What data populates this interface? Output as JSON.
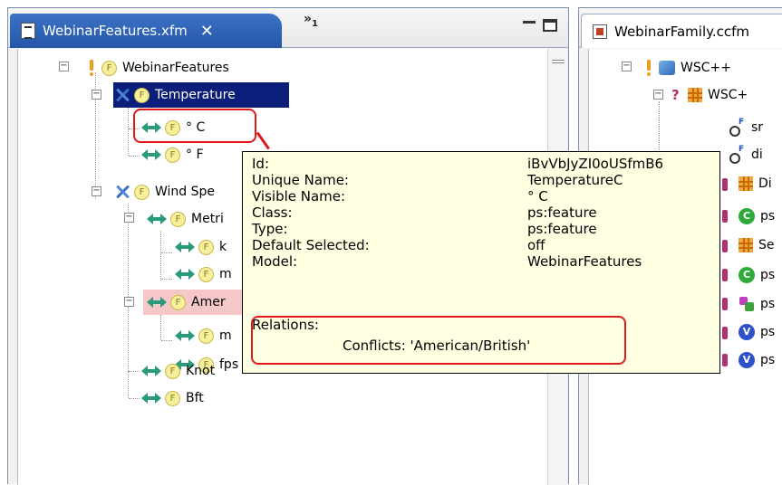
{
  "left_editor": {
    "tab_label": "WebinarFeatures.xfm",
    "close_glyph": "✕",
    "overflow_label": "»",
    "overflow_count": "1"
  },
  "tree": {
    "root": "WebinarFeatures",
    "temperature": "Temperature",
    "celsius": "° C",
    "fahrenheit": "° F",
    "wind_speed": "Wind Spe",
    "metric": "Metri",
    "metric_child_1": "k",
    "metric_child_2": "m",
    "american": "Amer",
    "american_child_1": "m",
    "american_child_2": "fps",
    "knot": "Knot",
    "bft": "Bft",
    "feature_icon_letter": "F"
  },
  "tooltip": {
    "rows": [
      {
        "key": "Id:",
        "value": "iBvVbJyZI0oUSfmB6"
      },
      {
        "key": "Unique Name:",
        "value": "TemperatureC"
      },
      {
        "key": "Visible Name:",
        "value": "° C"
      },
      {
        "key": "Class:",
        "value": "ps:feature"
      },
      {
        "key": "Type:",
        "value": "ps:feature"
      },
      {
        "key": "Default Selected:",
        "value": "off"
      },
      {
        "key": "Model:",
        "value": "WebinarFeatures"
      }
    ],
    "relations_label": "Relations:",
    "conflicts": "Conflicts: 'American/British'"
  },
  "right_editor": {
    "tab_label": "WebinarFamily.ccfm",
    "items": [
      {
        "label": "WSC++"
      },
      {
        "label": "WSC+"
      },
      {
        "label": "sr"
      },
      {
        "label": "di"
      },
      {
        "label": "Di"
      },
      {
        "label": "ps"
      },
      {
        "label": "Se"
      },
      {
        "label": "ps"
      },
      {
        "label": "ps"
      },
      {
        "label": "ps"
      },
      {
        "label": "ps"
      }
    ]
  },
  "colors": {
    "selection": "#0b1f7a",
    "conflict_row": "#f6c7c7",
    "tooltip_bg": "#ffffe1",
    "annotation_red": "#e01818",
    "active_tab": "#2456a8"
  }
}
